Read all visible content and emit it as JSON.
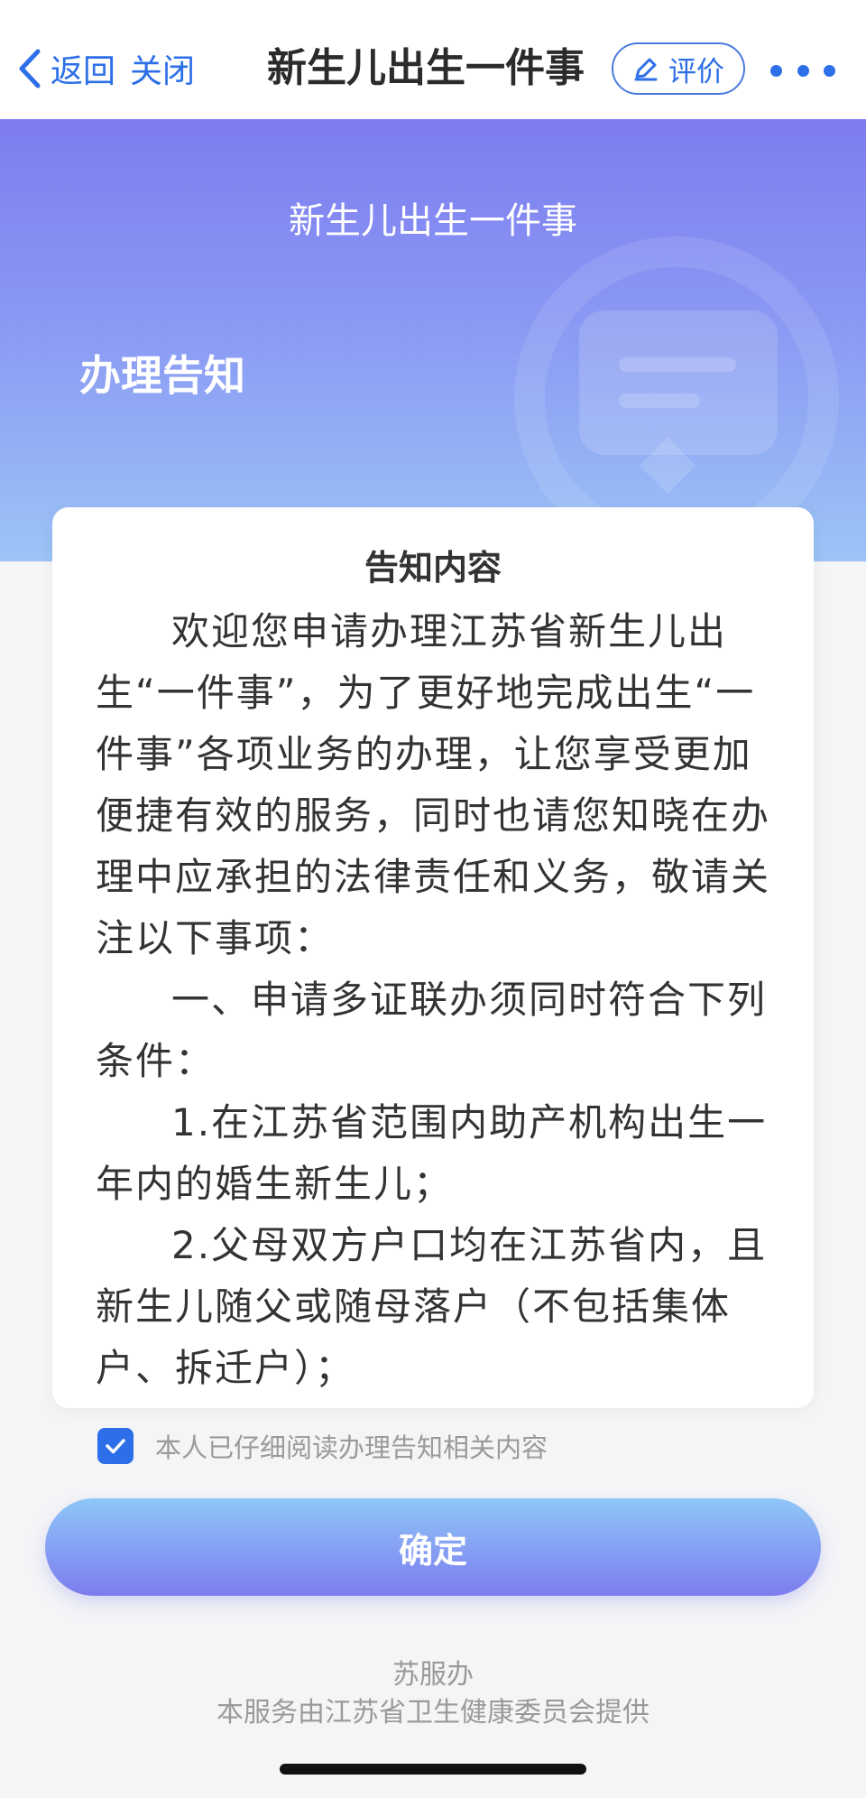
{
  "navbar": {
    "back_label": "返回",
    "close_label": "关闭",
    "title": "新生儿出生一件事",
    "eval_label": "评价",
    "back_icon": "chevron-left-icon",
    "eval_icon": "pencil-icon",
    "more_icon": "more-dots-icon"
  },
  "banner": {
    "title": "新生儿出生一件事",
    "heading": "办理告知",
    "decor_icon": "chat-bubble-icon"
  },
  "notice": {
    "title": "告知内容",
    "paragraphs": [
      "欢迎您申请办理江苏省新生儿出生“一件事”，为了更好地完成出生“一件事”各项业务的办理，让您享受更加便捷有效的服务，同时也请您知晓在办理中应承担的法律责任和义务，敬请关注以下事项：",
      "一、申请多证联办须同时符合下列条件：",
      "1.在江苏省范围内助产机构出生一年内的婚生新生儿；",
      "2.父母双方户口均在江苏省内，且新生儿随父或随母落户（不包括集体户、拆迁户）；"
    ]
  },
  "agreement": {
    "checked": true,
    "text": "本人已仔细阅读办理告知相关内容"
  },
  "confirm_label": "确定",
  "footer": {
    "brand": "苏服办",
    "provider": "本服务由江苏省卫生健康委员会提供"
  },
  "colors": {
    "accent": "#2d6fe8",
    "banner_top": "#7d7cf0",
    "banner_bottom": "#9cc4f6"
  }
}
